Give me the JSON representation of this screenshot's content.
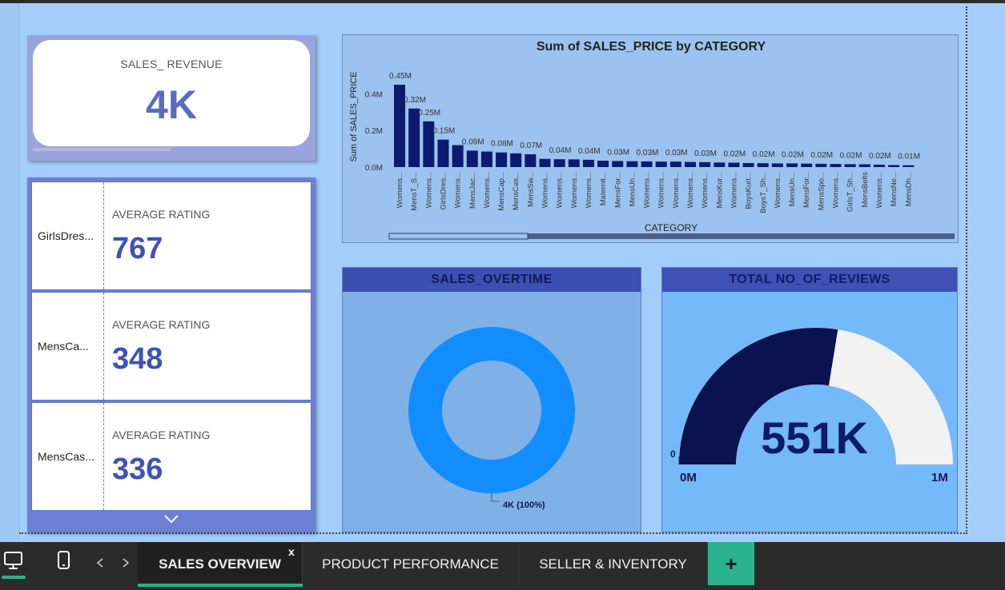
{
  "kpi": {
    "label": "SALES_ REVENUE",
    "value": "4K"
  },
  "multi_row_card": {
    "rows": [
      {
        "name": "GirlsDres...",
        "label": "AVERAGE RATING",
        "value": "767"
      },
      {
        "name": "MensCa...",
        "label": "AVERAGE RATING",
        "value": "348"
      },
      {
        "name": "MensCas...",
        "label": "AVERAGE RATING",
        "value": "336"
      }
    ],
    "more_icon": "chevron-down-icon"
  },
  "donut": {
    "title": "SALES_OVERTIME",
    "slice_label": "4K (100%)",
    "color": "#118dff"
  },
  "gauge": {
    "title": "TOTAL NO_OF_REVIEWS",
    "value_label": "551K",
    "min_label": "0M",
    "max_label": "1M",
    "target_label": "0",
    "fill_fraction": 0.551,
    "fill_color": "#0b1250",
    "empty_color": "#f2f2f2"
  },
  "chart_data": {
    "type": "bar",
    "title": "Sum of SALES_PRICE by CATEGORY",
    "xlabel": "CATEGORY",
    "ylabel": "Sum of SALES_PRICE",
    "ylim": [
      0,
      0.45
    ],
    "yticks": [
      "0.0M",
      "0.2M",
      "0.4M"
    ],
    "grid": false,
    "bar_color": "#0d1b6e",
    "categories": [
      "Womens...",
      "MensT_S...",
      "Womens...",
      "GirlsDres...",
      "Womens...",
      "MensJac...",
      "Womens...",
      "MensCap...",
      "MensCas...",
      "MensSw...",
      "Womens...",
      "Womens...",
      "Womens...",
      "Womens...",
      "Maternit...",
      "MensFor...",
      "MensUn...",
      "Womens...",
      "Womens...",
      "Womens...",
      "Womens...",
      "Womens...",
      "MensKur...",
      "Womens...",
      "BoysKurt...",
      "BoysT_Sh...",
      "Womens...",
      "MensUn...",
      "MensFor...",
      "MensSpo...",
      "Womens...",
      "GirlsT_Sh...",
      "MensBelts",
      "Womens...",
      "MensNe...",
      "MensDh..."
    ],
    "values": [
      0.45,
      0.32,
      0.25,
      0.15,
      0.12,
      0.09,
      0.085,
      0.08,
      0.075,
      0.07,
      0.045,
      0.043,
      0.042,
      0.04,
      0.035,
      0.033,
      0.032,
      0.031,
      0.03,
      0.03,
      0.028,
      0.027,
      0.025,
      0.024,
      0.022,
      0.021,
      0.02,
      0.02,
      0.019,
      0.018,
      0.017,
      0.016,
      0.015,
      0.013,
      0.011,
      0.01
    ],
    "data_labels": [
      "0.45M",
      "0.32M",
      "0.25M",
      "0.15M",
      "",
      "0.09M",
      "",
      "0.08M",
      "",
      "0.07M",
      "",
      "0.04M",
      "",
      "0.04M",
      "",
      "0.03M",
      "",
      "0.03M",
      "",
      "0.03M",
      "",
      "0.03M",
      "",
      "0.02M",
      "",
      "0.02M",
      "",
      "0.02M",
      "",
      "0.02M",
      "",
      "0.02M",
      "",
      "0.02M",
      "",
      "0.01M"
    ]
  },
  "tabbar": {
    "tabs": [
      {
        "label": "SALES OVERVIEW",
        "active": true
      },
      {
        "label": "PRODUCT PERFORMANCE",
        "active": false
      },
      {
        "label": "SELLER & INVENTORY",
        "active": false
      }
    ],
    "close_label": "x",
    "add_label": "+",
    "accent": "#2bb38f"
  }
}
